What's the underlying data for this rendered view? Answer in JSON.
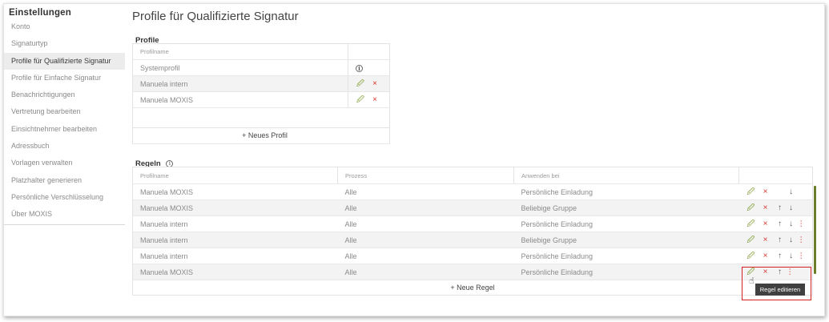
{
  "sidebar": {
    "title": "Einstellungen",
    "items": [
      {
        "label": "Konto"
      },
      {
        "label": "Signaturtyp"
      },
      {
        "label": "Profile für Qualifizierte Signatur",
        "active": true
      },
      {
        "label": "Profile für Einfache Signatur"
      },
      {
        "label": "Benachrichtigungen"
      },
      {
        "label": "Vertretung bearbeiten"
      },
      {
        "label": "Einsichtnehmer bearbeiten"
      },
      {
        "label": "Adressbuch"
      },
      {
        "label": "Vorlagen verwalten"
      },
      {
        "label": "Platzhalter generieren"
      },
      {
        "label": "Persönliche Verschlüsselung"
      },
      {
        "label": "Über MOXIS"
      }
    ]
  },
  "page": {
    "title": "Profile für Qualifizierte Signatur"
  },
  "profiles": {
    "label": "Profile",
    "header": "Profilname",
    "rows": [
      {
        "name": "Systemprofil",
        "info": "i"
      },
      {
        "name": "Manuela intern"
      },
      {
        "name": "Manuela MOXIS"
      }
    ],
    "new_button": "+ Neues Profil"
  },
  "rules": {
    "label": "Regeln",
    "info": "i",
    "headers": {
      "profile": "Profilname",
      "process": "Prozess",
      "apply": "Anwenden bei"
    },
    "rows": [
      {
        "profile": "Manuela MOXIS",
        "process": "Alle",
        "apply": "Persönliche Einladung"
      },
      {
        "profile": "Manuela MOXIS",
        "process": "Alle",
        "apply": "Beliebige Gruppe"
      },
      {
        "profile": "Manuela intern",
        "process": "Alle",
        "apply": "Persönliche Einladung"
      },
      {
        "profile": "Manuela intern",
        "process": "Alle",
        "apply": "Beliebige Gruppe"
      },
      {
        "profile": "Manuela intern",
        "process": "Alle",
        "apply": "Persönliche Einladung"
      },
      {
        "profile": "Manuela MOXIS",
        "process": "Alle",
        "apply": "Persönliche Einladung"
      }
    ],
    "new_button": "+ Neue Regel"
  },
  "icons": {
    "edit": "🖉",
    "delete": "×",
    "up": "↑",
    "down": "↓",
    "more": "⋮"
  },
  "tooltip": "Regel editieren",
  "colors": {
    "edit_icon": "#7a9a2a",
    "delete_icon": "#d9352b",
    "highlight": "#d32222",
    "scrollbar": "#6a7d2a"
  }
}
